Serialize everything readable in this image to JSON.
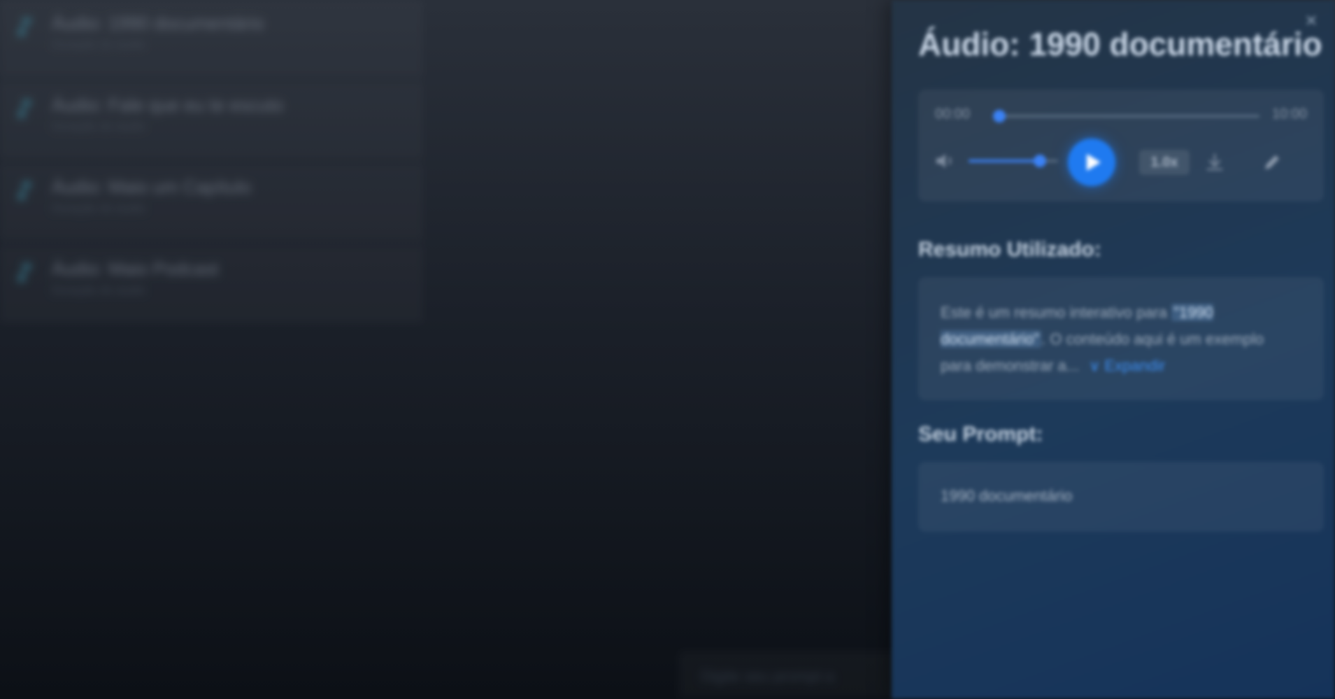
{
  "background_list": {
    "items": [
      {
        "title": "Áudio: 1990 documentário",
        "subtitle": "Duração do áudio"
      },
      {
        "title": "Áudio: Fale que eu te escuto",
        "subtitle": "Duração do áudio"
      },
      {
        "title": "Áudio: Maio um Capítulo",
        "subtitle": "Duração do áudio"
      },
      {
        "title": "Áudio: Maio Podcast",
        "subtitle": "Duração do áudio"
      }
    ]
  },
  "prompt_bar": {
    "placeholder": "Digite seu prompt a"
  },
  "panel": {
    "close_icon": "close-icon",
    "title": "Áudio: 1990 documentário",
    "player": {
      "current_time": "00:00",
      "duration": "10:00",
      "progress": 0.02,
      "volume": 0.8,
      "speed_label": "1.0x",
      "icons": {
        "volume": "volume-icon",
        "play": "play-icon",
        "download": "download-icon",
        "edit": "pencil-icon"
      }
    },
    "summary": {
      "heading": "Resumo Utilizado:",
      "text_before": "Este é um resumo interativo para ",
      "highlight": "\"1990 documentário\"",
      "text_after": ". O conteúdo aqui é um exemplo para demonstrar a...",
      "expand_label": "∨ Expandir"
    },
    "prompt": {
      "heading": "Seu Prompt:",
      "value": "1990 documentário"
    }
  },
  "colors": {
    "accent": "#1f7af0",
    "panel_bg": "#1d3a5a",
    "page_bg": "#1b2029"
  }
}
